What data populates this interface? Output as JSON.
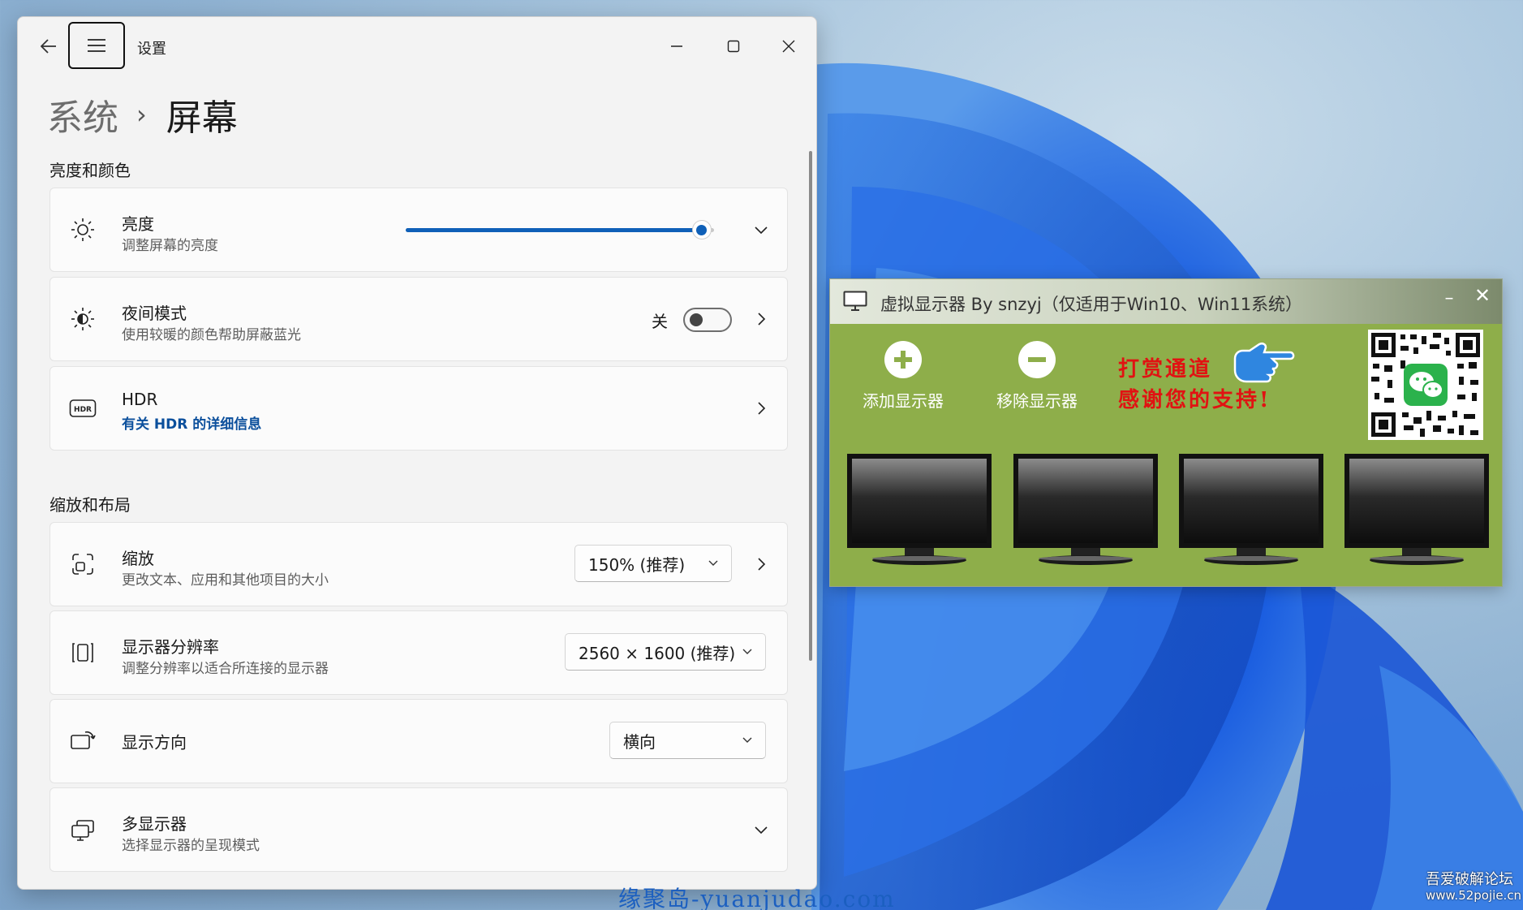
{
  "settings": {
    "app_title": "设置",
    "breadcrumb": {
      "parent": "系统",
      "separator": "›",
      "current": "屏幕"
    },
    "section_brightness": "亮度和颜色",
    "section_layout": "缩放和布局",
    "brightness": {
      "label": "亮度",
      "description": "调整屏幕的亮度",
      "value": 0.96
    },
    "night_mode": {
      "label": "夜间模式",
      "description": "使用较暖的颜色帮助屏蔽蓝光",
      "state": "关"
    },
    "hdr": {
      "label": "HDR",
      "description": "有关 HDR 的详细信息"
    },
    "scale": {
      "label": "缩放",
      "description": "更改文本、应用和其他项目的大小",
      "value": "150% (推荐)"
    },
    "resolution": {
      "label": "显示器分辨率",
      "description": "调整分辨率以适合所连接的显示器",
      "value": "2560 × 1600 (推荐)"
    },
    "orientation": {
      "label": "显示方向",
      "value": "横向"
    },
    "multi_display": {
      "label": "多显示器",
      "description": "选择显示器的呈现模式"
    }
  },
  "virtual_display": {
    "title": "虚拟显示器 By snzyj（仅适用于Win10、Win11系统）",
    "min_label": "–",
    "close_label": "✕",
    "add_label": "添加显示器",
    "remove_label": "移除显示器",
    "reward_line1": "打赏通道",
    "reward_line2": "感谢您的支持!",
    "background": "#8eae4a"
  },
  "watermarks": {
    "center": "缘聚岛-yuanjudao.com",
    "forum_name": "吾爱破解论坛",
    "forum_url": "www.52pojie.cn"
  },
  "colors": {
    "accent": "#0f60b8",
    "reward_red": "#e11212"
  }
}
